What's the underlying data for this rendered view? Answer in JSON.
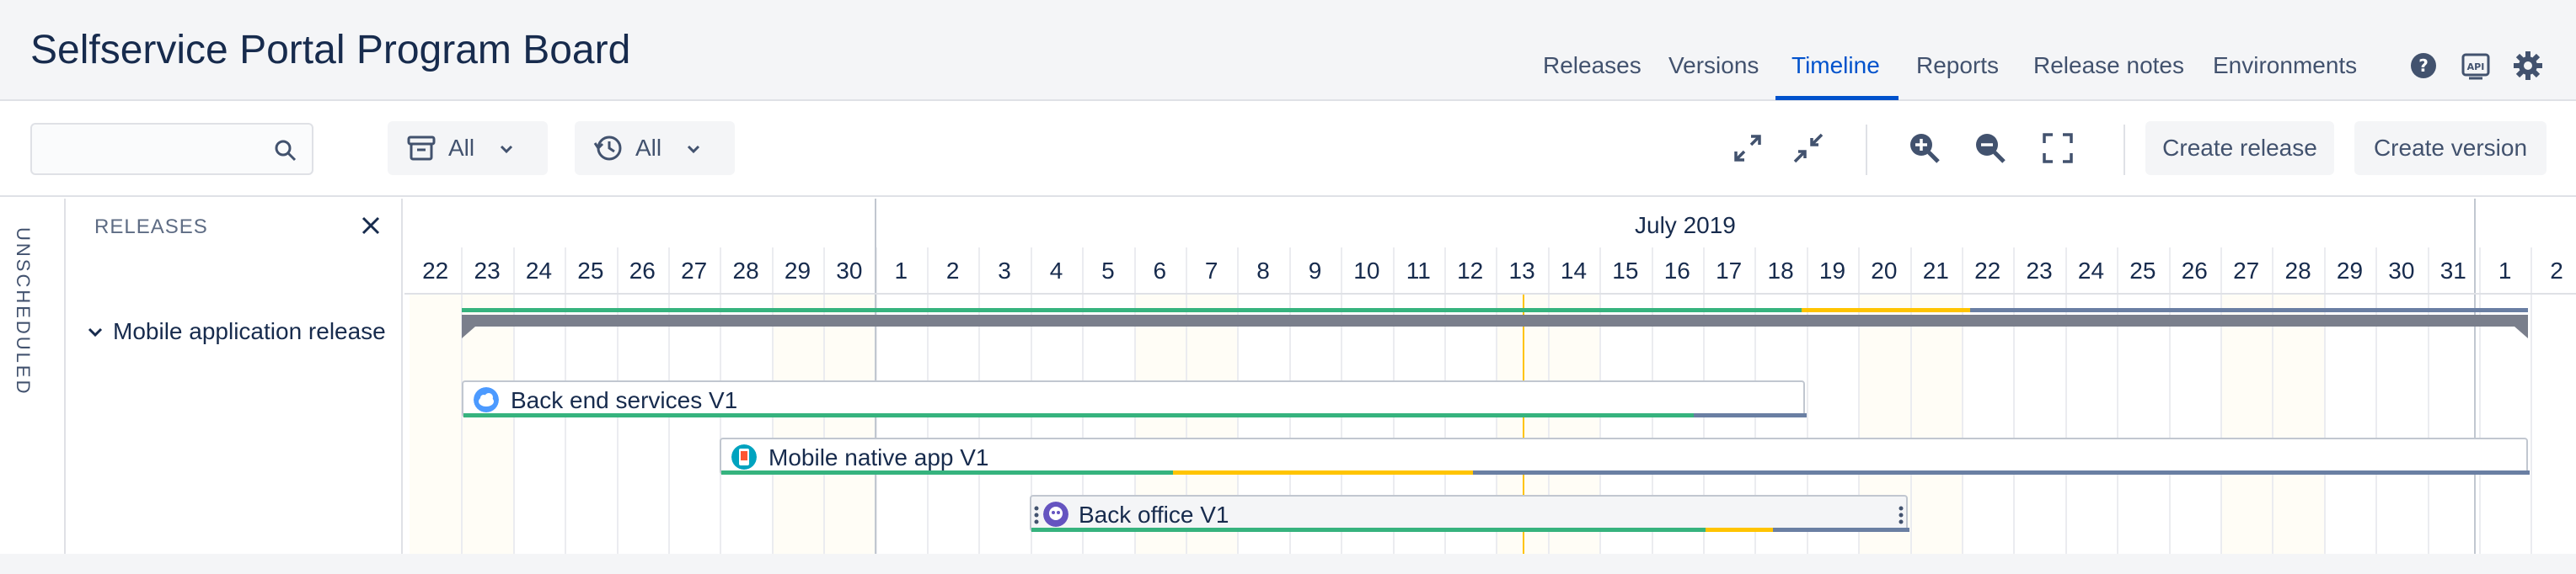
{
  "header": {
    "title": "Selfservice Portal Program Board",
    "nav": [
      "Releases",
      "Versions",
      "Timeline",
      "Reports",
      "Release notes",
      "Environments"
    ],
    "active_tab": "Timeline",
    "icons": [
      "help-icon",
      "api-icon",
      "gear-icon"
    ],
    "accent_color": "#0052cc"
  },
  "toolbar": {
    "search_value": "",
    "filter1_label": "All",
    "filter2_label": "All",
    "create_release_label": "Create release",
    "create_version_label": "Create version"
  },
  "sidebar": {
    "unscheduled_label": "UNSCHEDULED",
    "releases_heading": "RELEASES",
    "release_item": "Mobile application release"
  },
  "timeline": {
    "month_label": "July 2019",
    "days": [
      "22",
      "23",
      "24",
      "25",
      "26",
      "27",
      "28",
      "29",
      "30",
      "1",
      "2",
      "3",
      "4",
      "5",
      "6",
      "7",
      "8",
      "9",
      "10",
      "11",
      "12",
      "13",
      "14",
      "15",
      "16",
      "17",
      "18",
      "19",
      "20",
      "21",
      "22",
      "23",
      "24",
      "25",
      "26",
      "27",
      "28",
      "29",
      "30",
      "31",
      "1",
      "2"
    ],
    "today": "13",
    "versions": [
      {
        "name": "Back end services V1",
        "icon": "cloud-icon",
        "start": "June 23",
        "end": "July 18"
      },
      {
        "name": "Mobile native app V1",
        "icon": "phone-app-icon",
        "start": "June 28",
        "end": "August 1"
      },
      {
        "name": "Back office V1",
        "icon": "robot-icon",
        "start": "July 4",
        "end": "July 20"
      }
    ],
    "colors": {
      "done": "#36b37e",
      "in_progress": "#ffc400",
      "todo": "#6a7fa3",
      "release_bar": "#7a7f8c"
    }
  }
}
